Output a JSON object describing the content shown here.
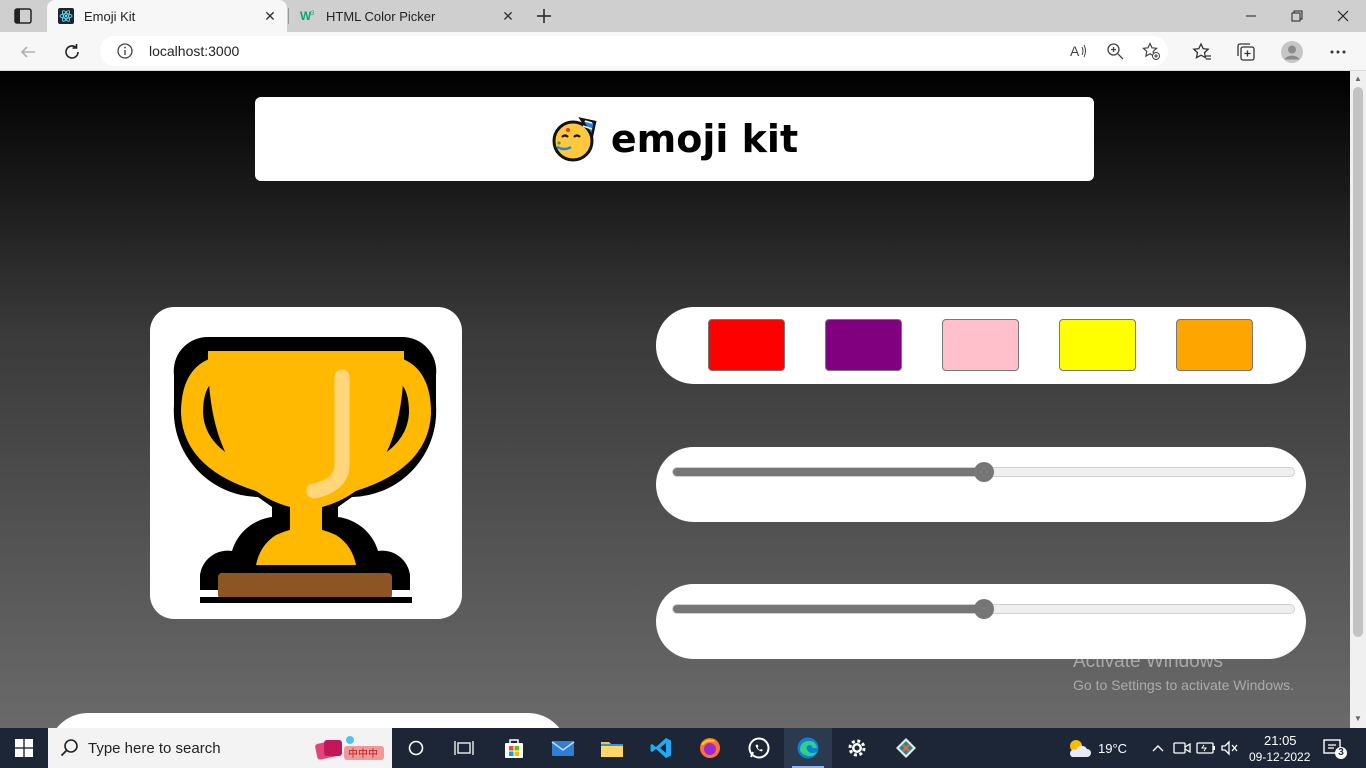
{
  "browser": {
    "tabs": [
      {
        "title": "Emoji Kit",
        "active": true
      },
      {
        "title": "HTML Color Picker",
        "active": false
      }
    ],
    "url": "localhost:3000"
  },
  "app": {
    "title": "emoji kit",
    "swatch_colors": [
      "#ff0000",
      "#800080",
      "#ffc0cb",
      "#ffff00",
      "#ffa500"
    ],
    "slider1_value": 0.5,
    "slider2_value": 0.5,
    "emoji_icon": "trophy-icon"
  },
  "watermark": {
    "line1": "Activate Windows",
    "line2": "Go to Settings to activate Windows."
  },
  "taskbar": {
    "search_placeholder": "Type here to search",
    "weather": "19°C",
    "time": "21:05",
    "date": "09-12-2022",
    "notification_count": "3"
  }
}
